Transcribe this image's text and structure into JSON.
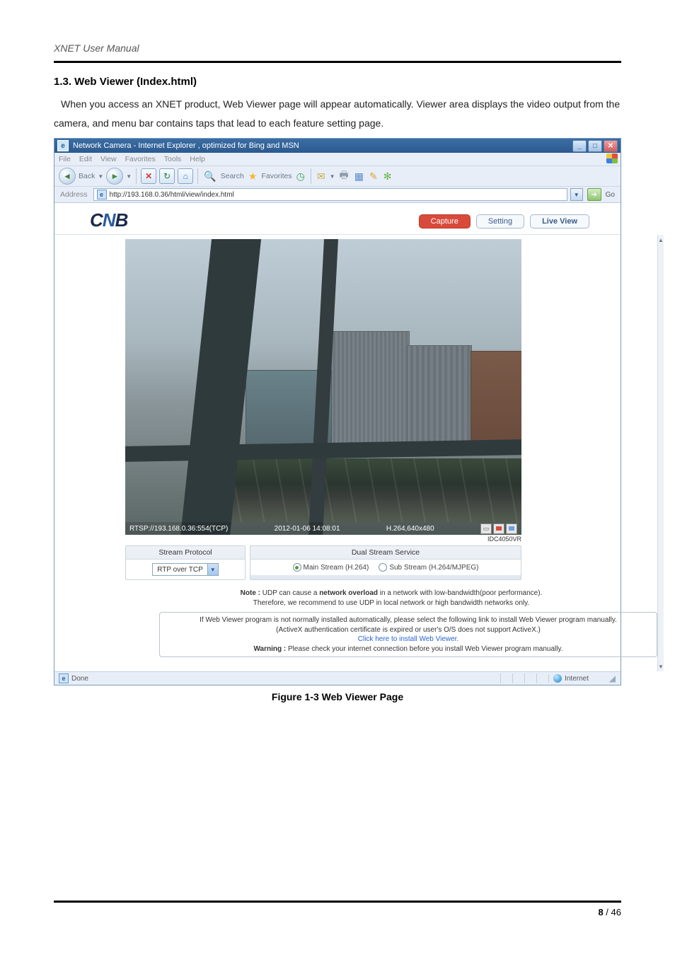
{
  "doc": {
    "running_header": "XNET User Manual",
    "section_title": "1.3. Web Viewer (Index.html)",
    "para": "When you access an XNET product, Web Viewer page will appear automatically. Viewer area displays the video output from the camera, and menu bar contains taps that lead to each feature setting page.",
    "figure_caption": "Figure 1-3 Web Viewer Page",
    "page_current": "8",
    "page_sep": " / ",
    "page_total": "46"
  },
  "browser": {
    "title": "Network Camera - Internet Explorer , optimized for Bing and MSN",
    "menus": [
      "File",
      "Edit",
      "View",
      "Favorites",
      "Tools",
      "Help"
    ],
    "back_label": "Back",
    "search_label": "Search",
    "fav_label": "Favorites",
    "address_label": "Address",
    "address_value": "http://193.168.0.36/html/view/index.html",
    "go_label": "Go"
  },
  "app": {
    "brand_left": "C",
    "brand_mid": "N",
    "brand_right": "B",
    "btn_capture": "Capture",
    "btn_setting": "Setting",
    "btn_liveview": "Live View",
    "overlay": {
      "rtsp": "RTSP://193.168.0.36:554(TCP)",
      "timestamp": "2012-01-06 14:08:01",
      "codec": "H.264,640x480"
    },
    "device_id": "IDC4050VR",
    "panels": {
      "stream_protocol_head": "Stream Protocol",
      "stream_protocol_value": "RTP over TCP",
      "dual_head": "Dual Stream Service",
      "main_stream": "Main Stream (H.264)",
      "sub_stream": "Sub Stream (H.264/MJPEG)"
    },
    "note_prefix": "Note : ",
    "note_line1a": "UDP can cause a ",
    "note_bold": "network overload",
    "note_line1b": " in a network with low-bandwidth(poor performance).",
    "note_line2": "Therefore, we recommend to use UDP in local network or high bandwidth networks only.",
    "install": {
      "line1": "If Web Viewer program is not normally installed automatically, please select the following link to install Web Viewer program manually.",
      "line2": "(ActiveX authentication certificate is expired or user's O/S does not support ActiveX.)",
      "link": "Click here to install Web Viewer.",
      "warn_prefix": "Warning : ",
      "warn": "Please check your internet connection before you install Web Viewer program manually."
    }
  },
  "status": {
    "done": "Done",
    "zone": "Internet"
  }
}
